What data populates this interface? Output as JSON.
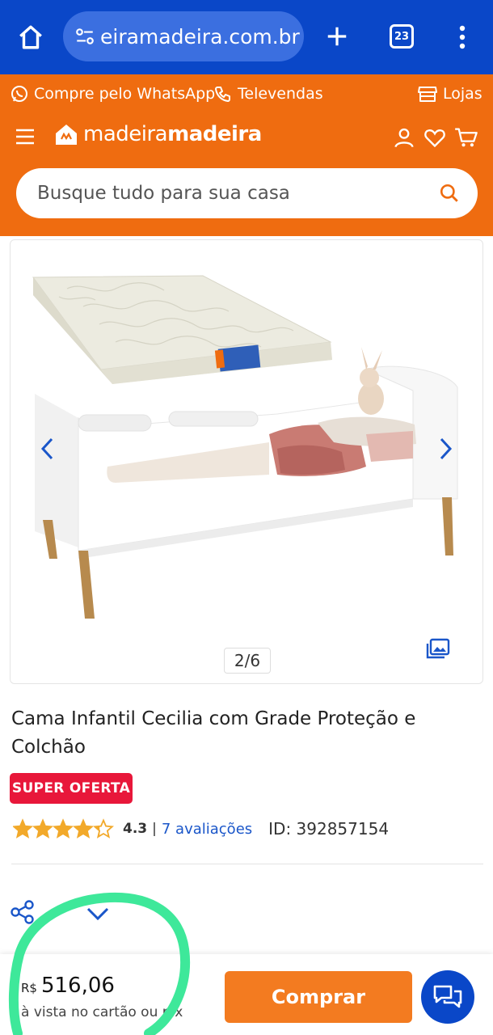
{
  "browser": {
    "url": "еiramadeira.com.br",
    "tab_count": "23"
  },
  "header": {
    "whatsapp_label": "Compre pelo WhatsApp",
    "televendas_label": "Televendas",
    "lojas_label": "Lojas",
    "logo_light": "madeira",
    "logo_bold": "madeira",
    "search_placeholder": "Busque tudo para sua casa"
  },
  "gallery": {
    "counter": "2/6"
  },
  "product": {
    "title": "Cama Infantil Cecilia com Grade Proteção e Colchão",
    "badge": "SUPER OFERTA",
    "rating": "4.3",
    "rating_fraction": 0.86,
    "separator": "|",
    "reviews": "7 avaliações",
    "product_id": "ID: 392857154"
  },
  "purchase": {
    "currency": "R$",
    "price": "516,06",
    "price_note": "à vista no cartão ou pix",
    "buy_label": "Comprar"
  },
  "colors": {
    "browser_blue": "#0a47c8",
    "brand_orange": "#ef6c10",
    "buy_orange": "#f37b20",
    "badge_red": "#e8173a",
    "star_yellow": "#f2a92a",
    "annotation_green": "#3ee89a"
  },
  "icons": [
    "home-icon",
    "tune-icon",
    "plus-icon",
    "tabs-icon",
    "more-vert-icon",
    "whatsapp-icon",
    "phone-icon",
    "store-icon",
    "menu-icon",
    "logo-icon",
    "user-icon",
    "heart-icon",
    "cart-icon",
    "search-icon",
    "chevron-left-icon",
    "chevron-right-icon",
    "image-gallery-icon",
    "share-icon",
    "chevron-down-icon",
    "chat-icon"
  ]
}
